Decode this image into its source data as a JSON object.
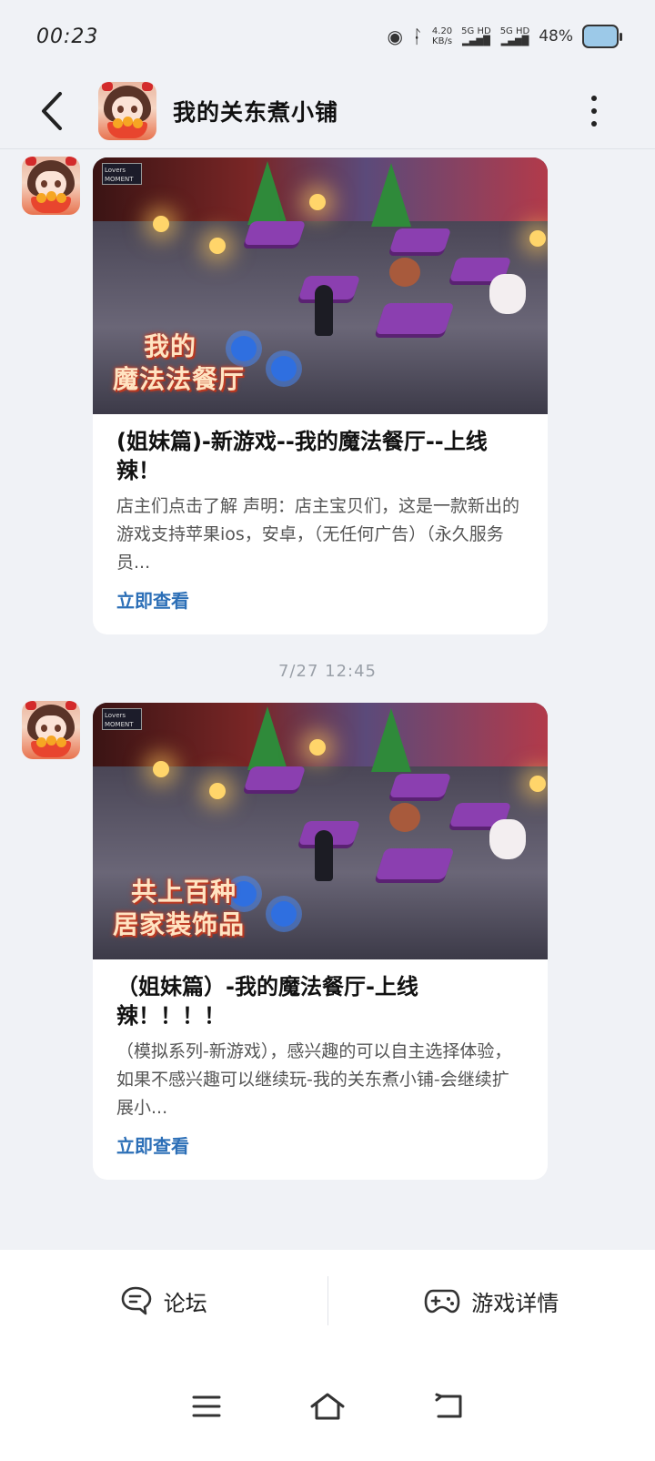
{
  "status_bar": {
    "time": "00:23",
    "net_speed_value": "4.20",
    "net_speed_unit": "KB/s",
    "signal_1": "5G HD",
    "signal_2": "5G HD",
    "battery": "48%"
  },
  "header": {
    "title": "我的关东煮小铺",
    "back_icon": "chevron-left-icon",
    "more_icon": "more-vertical-icon"
  },
  "messages": [
    {
      "image_caption_line1": "我的",
      "image_caption_line2": "魔法法餐厅",
      "image_badge_line1": "Lovers",
      "image_badge_line2": "MOMENT",
      "title": "(姐妹篇)-新游戏--我的魔法餐厅--上线辣！",
      "description": "店主们点击了解 声明：店主宝贝们，这是一款新出的游戏支持苹果ios，安卓，（无任何广告）（永久服务员...",
      "link": "立即查看"
    },
    {
      "image_caption_line1": "共上百种",
      "image_caption_line2": "居家装饰品",
      "image_badge_line1": "Lovers",
      "image_badge_line2": "MOMENT",
      "title": "（姐妹篇）-我的魔法餐厅-上线辣！！！！",
      "description": "（模拟系列-新游戏），感兴趣的可以自主选择体验，如果不感兴趣可以继续玩-我的关东煮小铺-会继续扩展小...",
      "link": "立即查看"
    }
  ],
  "timestamp": "7/27  12:45",
  "bottom_bar": {
    "forum_label": "论坛",
    "game_details_label": "游戏详情"
  },
  "colors": {
    "link": "#2c6fb7",
    "background": "#f0f2f6",
    "card": "#ffffff"
  }
}
